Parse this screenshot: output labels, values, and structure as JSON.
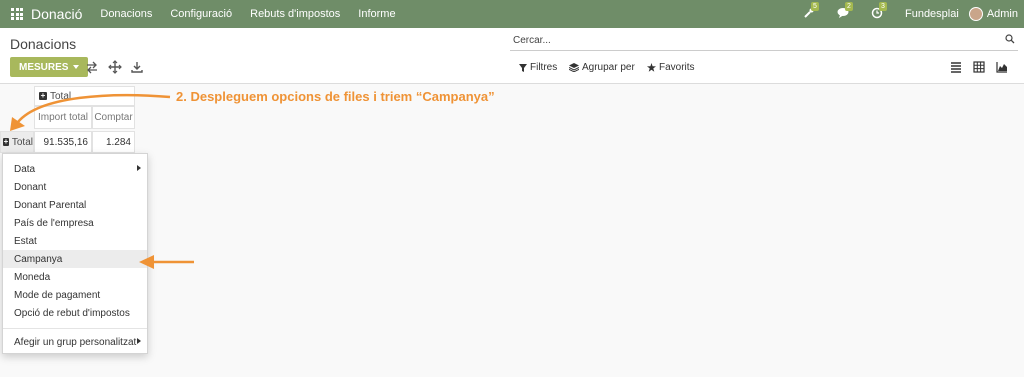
{
  "topbar": {
    "app_name": "Donació",
    "menus": [
      "Donacions",
      "Configuració",
      "Rebuts d'impostos",
      "Informe"
    ],
    "badges": {
      "activities": "5",
      "messages": "2",
      "clock": "3"
    },
    "company": "Fundesplai",
    "user": "Admin",
    "colors": {
      "bar": "#6f8d68",
      "badge": "#a4b94f"
    }
  },
  "page": {
    "title": "Donacions",
    "search_placeholder": "Cercar...",
    "measures_label": "MESURES",
    "filters_label": "Filtres",
    "group_label": "Agrupar per",
    "favorites_label": "Favorits"
  },
  "pivot": {
    "col_header": "Total",
    "measure_headers": [
      "Import total",
      "Comptar"
    ],
    "row_header": "Total",
    "values": [
      "91.535,16",
      "1.284"
    ]
  },
  "dropdown": {
    "items": [
      "Data",
      "Donant",
      "Donant Parental",
      "País de l'empresa",
      "Estat",
      "Campanya",
      "Moneda",
      "Mode de pagament",
      "Opció de rebut d'impostos"
    ],
    "selected": "Campanya",
    "custom_group": "Afegir un grup personalitzat"
  },
  "annotation": {
    "text": "2. Despleguem opcions de files i triem  “Campanya”",
    "color": "#ef9336"
  }
}
